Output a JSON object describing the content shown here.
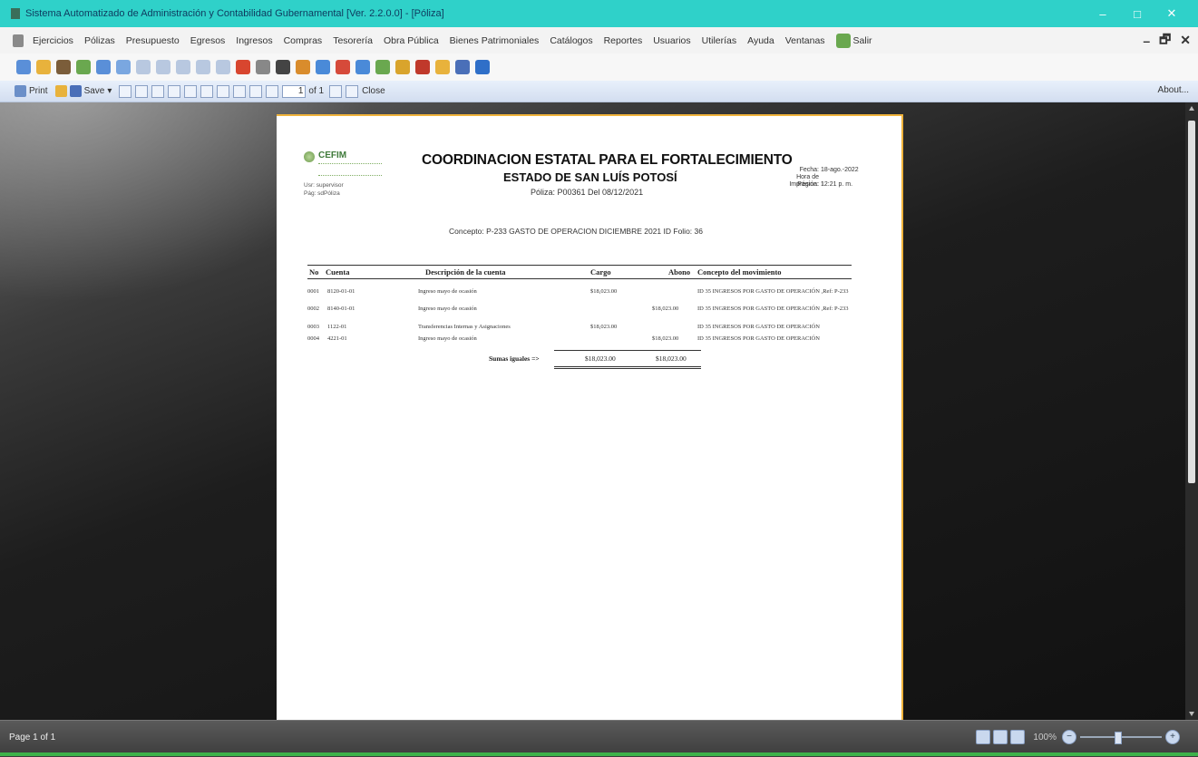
{
  "window": {
    "title": "Sistema Automatizado de Administración y Contabilidad Gubernamental  [Ver. 2.2.0.0] - [Póliza]",
    "minimize": "–",
    "maximize": "□",
    "close": "✕"
  },
  "menu": {
    "items": [
      "Ejercicios",
      "Pólizas",
      "Presupuesto",
      "Egresos",
      "Ingresos",
      "Compras",
      "Tesorería",
      "Obra Pública",
      "Bienes Patrimoniales",
      "Catálogos",
      "Reportes",
      "Usuarios",
      "Utilerías",
      "Ayuda",
      "Ventanas"
    ],
    "exit_label": "Salir",
    "mdi_minimize": "–",
    "mdi_restore": "🗗",
    "mdi_close": "✕"
  },
  "toolbar_icons": [
    {
      "name": "refresh-icon",
      "color": "#5a8fd8"
    },
    {
      "name": "folder-icon",
      "color": "#e8b23c"
    },
    {
      "name": "briefcase-icon",
      "color": "#7b5d3a"
    },
    {
      "name": "money-icon",
      "color": "#6aa84f"
    },
    {
      "name": "document-icon",
      "color": "#5a8fd8"
    },
    {
      "name": "report-icon",
      "color": "#7aa7e0"
    },
    {
      "name": "grid-icon",
      "color": "#b8c8e0"
    },
    {
      "name": "grid-icon",
      "color": "#b8c8e0"
    },
    {
      "name": "grid-icon",
      "color": "#b8c8e0"
    },
    {
      "name": "grid-icon",
      "color": "#b8c8e0"
    },
    {
      "name": "grid-icon",
      "color": "#b8c8e0"
    },
    {
      "name": "chart-icon",
      "color": "#d8462f"
    },
    {
      "name": "gear-icon",
      "color": "#888"
    },
    {
      "name": "calculator-icon",
      "color": "#444"
    },
    {
      "name": "pie-chart-icon",
      "color": "#d98c2c"
    },
    {
      "name": "bar-chart-icon",
      "color": "#4a8ad8"
    },
    {
      "name": "pin-icon",
      "color": "#d64a3a"
    },
    {
      "name": "list-icon",
      "color": "#4a8ad8"
    },
    {
      "name": "tools-icon",
      "color": "#6aa84f"
    },
    {
      "name": "shield-icon",
      "color": "#d9a42c"
    },
    {
      "name": "tree-icon",
      "color": "#c0392b"
    },
    {
      "name": "people-icon",
      "color": "#e8b23c"
    },
    {
      "name": "save-icon",
      "color": "#4a6fb8"
    },
    {
      "name": "help-icon",
      "color": "#2f6fc8"
    }
  ],
  "viewer": {
    "print_label": "Print",
    "save_label": "Save",
    "page_input": "1",
    "page_of": "of 1",
    "close_label": "Close",
    "about_label": "About..."
  },
  "report": {
    "logo_text": "CEFIM",
    "user_line1": "Usr: supervisor",
    "user_line2": "Pág: sdPóliza",
    "header_line1": "COORDINACION ESTATAL PARA EL FORTALECIMIENTO",
    "header_line2": "ESTADO DE SAN LUÍS POTOSÍ",
    "header_line3": "Póliza:  P00361  Del 08/12/2021",
    "meta_fecha_label": "Fecha:",
    "meta_fecha": "18-ago.-2022",
    "meta_hora_label": "Hora de Impresión:",
    "meta_hora": "12:21 p. m.",
    "meta_pagina_label": "Página:",
    "meta_pagina": "1",
    "concepto": "Concepto: P-233  GASTO DE OPERACION DICIEMBRE 2021 ID Folio: 36",
    "columns": {
      "no": "No",
      "cuenta": "Cuenta",
      "descripcion": "Descripción de la cuenta",
      "cargo": "Cargo",
      "abono": "Abono",
      "concepto": "Concepto del movimiento"
    },
    "rows": [
      {
        "no": "0001",
        "cuenta": "8120-01-01",
        "descripcion": "Ingreso mayo de ocasión",
        "cargo": "$18,023.00",
        "abono": "",
        "concepto": "ID 35 INGRESOS POR GASTO DE OPERACIÓN ,Ref: P-233"
      },
      {
        "no": "0002",
        "cuenta": "8140-01-01",
        "descripcion": "Ingreso mayo de ocasión",
        "cargo": "",
        "abono": "$18,023.00",
        "concepto": "ID 35 INGRESOS POR GASTO DE OPERACIÓN ,Ref: P-233"
      },
      {
        "no": "0003",
        "cuenta": "1122-01",
        "descripcion": "Transferencias Internas y Asignaciones",
        "cargo": "$18,023.00",
        "abono": "",
        "concepto": "ID 35 INGRESOS POR GASTO DE OPERACIÓN"
      },
      {
        "no": "0004",
        "cuenta": "4221-01",
        "descripcion": "Ingreso mayo de ocasión",
        "cargo": "",
        "abono": "$18,023.00",
        "concepto": "ID 35 INGRESOS POR GASTO DE OPERACIÓN"
      }
    ],
    "totals_label": "Sumas iguales =>",
    "total_cargo": "$18,023.00",
    "total_abono": "$18,023.00"
  },
  "status": {
    "page_label": "Page 1 of 1",
    "zoom_pct": "100%"
  }
}
